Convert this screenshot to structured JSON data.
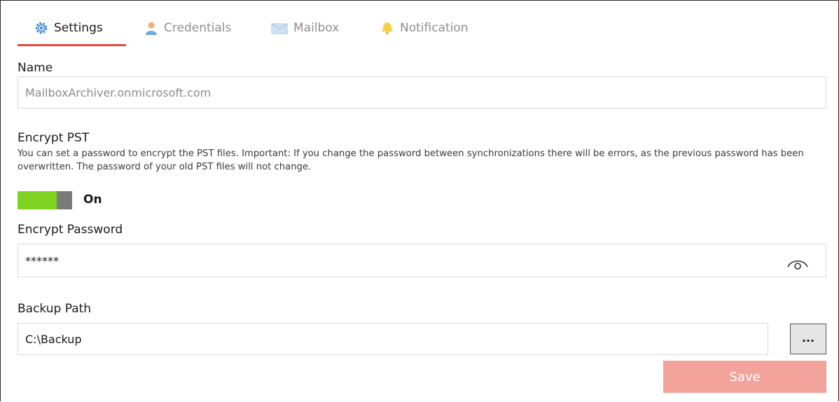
{
  "tabs": [
    {
      "label": "Settings",
      "icon": "gear-icon",
      "active": true
    },
    {
      "label": "Credentials",
      "icon": "user-icon",
      "active": false
    },
    {
      "label": "Mailbox",
      "icon": "envelope-icon",
      "active": false
    },
    {
      "label": "Notification",
      "icon": "bell-icon",
      "active": false
    }
  ],
  "name": {
    "label": "Name",
    "value": "MailboxArchiver.onmicrosoft.com"
  },
  "encrypt": {
    "label": "Encrypt PST",
    "description": "You can set a password to encrypt the PST files. Important: If you change the password between synchronizations there will be errors, as the previous password has been overwritten. The password of your old PST files will not change.",
    "toggle_state": "On"
  },
  "password": {
    "label": "Encrypt Password",
    "value": "******"
  },
  "backup": {
    "label": "Backup Path",
    "value": "C:\\Backup",
    "browse_label": "..."
  },
  "save_label": "Save",
  "colors": {
    "accent": "#e24a3b",
    "toggle_on": "#7ed321",
    "save_disabled": "#f2a39c"
  }
}
